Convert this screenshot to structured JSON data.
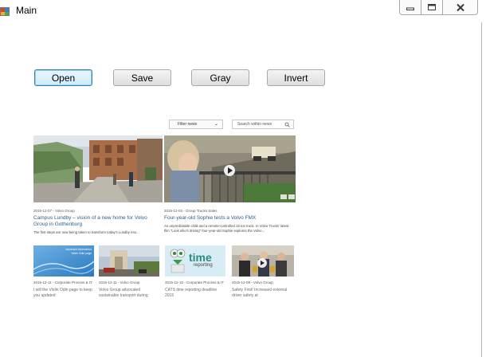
{
  "window": {
    "title": "Main"
  },
  "toolbar": {
    "open_label": "Open",
    "save_label": "Save",
    "gray_label": "Gray",
    "invert_label": "Invert"
  },
  "picture": {
    "filter_label": "Filter news",
    "search_placeholder": "Search within news",
    "featured": [
      {
        "date": "2015-12-07 - Volvo Group",
        "headline": "Campus Lundby – vision of a new home for Volvo Group in Gothenburg",
        "body": "The first steps are now being taken to transform today's Lundby into..."
      },
      {
        "date": "2015-12-03 - Group Trucks Sales",
        "headline": "Four-year-old Sophie tests a Volvo FMX",
        "body": "An unpredictable child and a remote-controlled 15 ton truck. In Volvo Trucks' latest film \"Look who's driving\" four-year-old Sophie explores the Volvo..."
      }
    ],
    "small": [
      {
        "date": "2015-12-11 - Corporate Process & IT",
        "headline": "I will the Violin Odin page to keep you updated",
        "thumb_text": "Important Information Violin Odin page"
      },
      {
        "date": "2015-12-11 - Volvo Group",
        "headline": "Volvo Group advocated sustainable transport during"
      },
      {
        "date": "2015-12-10 - Corporate Process & IT",
        "headline": "CATS time reporting deadline 2015",
        "thumb_text_1": "time",
        "thumb_text_2": "reporting"
      },
      {
        "date": "2015-12-09 - Volvo Group",
        "headline": "Safety First! Increased external driver safety at"
      }
    ]
  },
  "colors": {
    "link_blue": "#2a5f8a",
    "button_focus_border": "#3c7fb1"
  }
}
